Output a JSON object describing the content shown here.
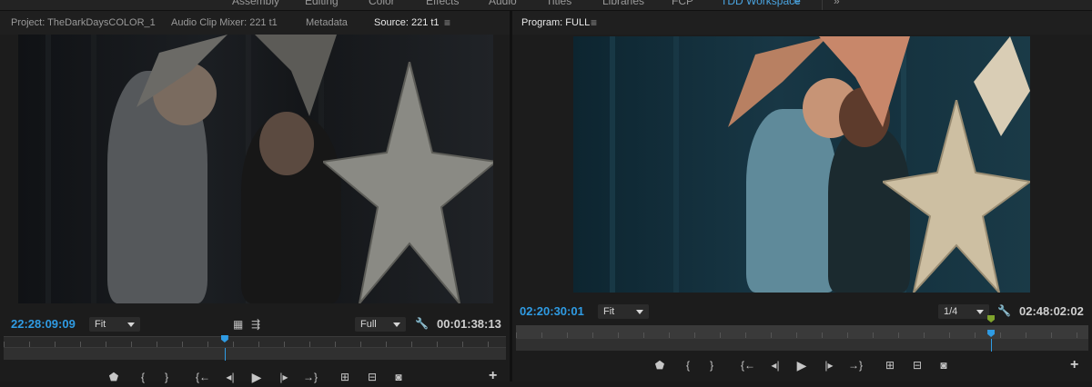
{
  "workspace": {
    "items": [
      "Assembly",
      "Editing",
      "Color",
      "Effects",
      "Audio",
      "Titles",
      "Libraries",
      "FCP",
      "TDD Workspace"
    ],
    "active_index": 8,
    "active_menu": "≡",
    "overflow": "»"
  },
  "source_panel": {
    "tabs": [
      "Project: TheDarkDaysCOLOR_1",
      "Audio Clip Mixer: 221 t1",
      "Metadata",
      "Source: 221 t1"
    ],
    "active_tab_index": 3,
    "tab_menu": "≡",
    "timecode_current": "22:28:09:09",
    "zoom_value": "Fit",
    "resolution_value": "Full",
    "timecode_duration": "00:01:38:13",
    "playhead_fraction": 0.44
  },
  "program_panel": {
    "tab": "Program: FULL",
    "tab_menu": "≡",
    "timecode_current": "02:20:30:01",
    "zoom_value": "Fit",
    "resolution_value": "1/4",
    "timecode_duration": "02:48:02:02",
    "playhead_fraction": 0.83
  },
  "icons": {
    "marker": "marker-icon",
    "mark_in": "mark-in-icon",
    "mark_out": "mark-out-icon",
    "go_to_in": "go-to-in-icon",
    "step_back": "step-back-icon",
    "play": "play-icon",
    "step_forward": "step-forward-icon",
    "go_to_out": "go-to-out-icon",
    "insert": "insert-icon",
    "overwrite": "overwrite-icon",
    "export_frame": "camera-icon",
    "add": "plus-icon",
    "settings": "wrench-icon",
    "drag_video": "film-icon",
    "drag_audio": "waveform-icon"
  },
  "glyphs": {
    "marker": "⬟",
    "mark_in": "{",
    "mark_out": "}",
    "go_to_in": "{←",
    "step_back": "◂|",
    "play": "▶",
    "step_forward": "|▸",
    "go_to_out": "→}",
    "insert": "⊞",
    "overwrite": "⊟",
    "export_frame": "◙",
    "add": "+",
    "settings": "🔧",
    "drag_video": "▦",
    "drag_audio": "⇶"
  },
  "colors": {
    "accent": "#2f9be3",
    "marker_green": "#7fa32c"
  }
}
